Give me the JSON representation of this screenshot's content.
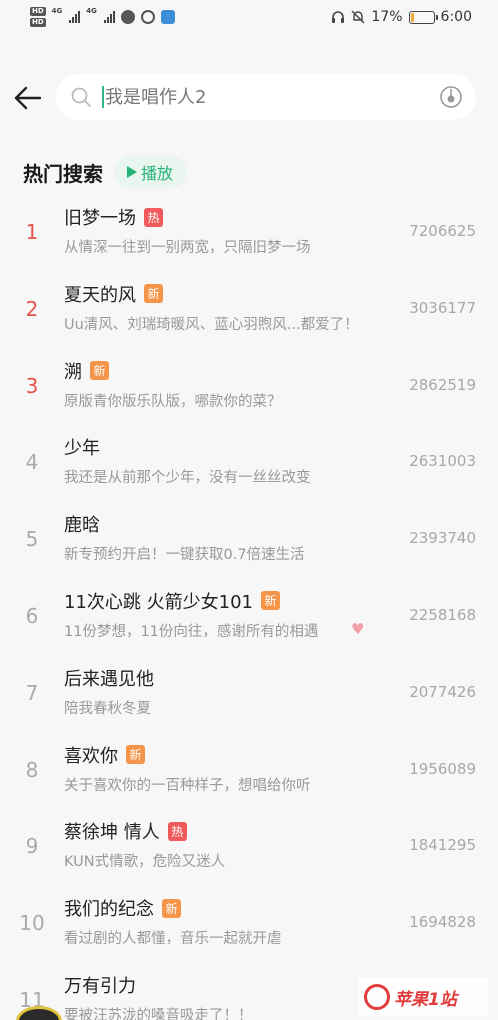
{
  "status_bar": {
    "hd_labels": [
      "HD",
      "HD"
    ],
    "net_labels": [
      "4G",
      "4G"
    ],
    "battery_text": "17%",
    "battery_level": 0.17,
    "time": "6:00"
  },
  "search": {
    "placeholder": "我是唱作人2"
  },
  "section": {
    "title": "热门搜索",
    "play_label": "播放"
  },
  "hot_list": [
    {
      "rank": "1",
      "title": "旧梦一场",
      "badge": "热",
      "desc": "从情深一往到一别两宽，只隔旧梦一场",
      "count": "7206625"
    },
    {
      "rank": "2",
      "title": "夏天的风",
      "badge": "新",
      "desc": "Uu清风、刘瑞琦暖风、蓝心羽煦风...都爱了！",
      "count": "3036177"
    },
    {
      "rank": "3",
      "title": "溯",
      "badge": "新",
      "desc": "原版青你版乐队版，哪款你的菜？",
      "count": "2862519"
    },
    {
      "rank": "4",
      "title": "少年",
      "badge": "",
      "desc": "我还是从前那个少年，没有一丝丝改变",
      "count": "2631003"
    },
    {
      "rank": "5",
      "title": "鹿晗",
      "badge": "",
      "desc": "新专预约开启！一键获取0.7倍速生活",
      "count": "2393740"
    },
    {
      "rank": "6",
      "title": "11次心跳 火箭少女101",
      "badge": "新",
      "desc": "11份梦想，11份向往，感谢所有的相遇",
      "count": "2258168"
    },
    {
      "rank": "7",
      "title": "后来遇见他",
      "badge": "",
      "desc": "陪我春秋冬夏",
      "count": "2077426"
    },
    {
      "rank": "8",
      "title": "喜欢你",
      "badge": "新",
      "desc": "关于喜欢你的一百种样子，想唱给你听",
      "count": "1956089"
    },
    {
      "rank": "9",
      "title": "蔡徐坤 情人",
      "badge": "热",
      "desc": "KUN式情歌，危险又迷人",
      "count": "1841295"
    },
    {
      "rank": "10",
      "title": "我们的纪念",
      "badge": "新",
      "desc": "看过剧的人都懂，音乐一起就开虐",
      "count": "1694828"
    },
    {
      "rank": "11",
      "title": "万有引力",
      "badge": "",
      "desc": "要被汪苏泷的嗓音吸走了！！",
      "count": ""
    }
  ],
  "watermark": "苹果1站",
  "colors": {
    "accent_green": "#25b378",
    "rank_top": "#e5534b",
    "badge_hot": "#f05a5a",
    "badge_new": "#f5954a"
  }
}
